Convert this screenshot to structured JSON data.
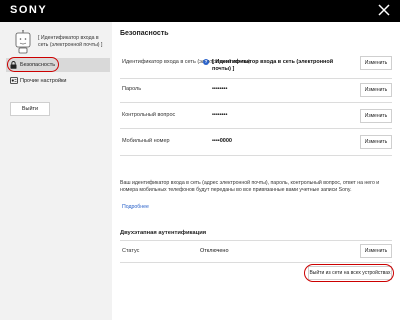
{
  "header": {
    "brand": "SONY"
  },
  "sidebar": {
    "account_id": "[ Идентификатор входа в сеть (электронной почты) ]",
    "nav": [
      {
        "label": "Безопасность"
      },
      {
        "label": "Прочие настройки"
      }
    ],
    "logout_label": "Выйти"
  },
  "main": {
    "title": "Безопасность",
    "rows": [
      {
        "label": "Идентификатор входа в сеть (электронной почты)",
        "value": "[ Идентификатор входа в сеть (электронной почты) ]",
        "button": "Изменить"
      },
      {
        "label": "Пароль",
        "value": "••••••••",
        "button": "Изменить"
      },
      {
        "label": "Контрольный вопрос",
        "value": "••••••••",
        "button": "Изменить"
      },
      {
        "label": "Мобильный номер",
        "value": "••••0000",
        "button": "Изменить"
      }
    ],
    "note": "Ваш идентификатор входа в сеть (адрес электронной почты), пароль, контрольный вопрос, ответ на него и номера мобильных телефонов будут переданы во все привязанные вами учетные записи Sony.",
    "more_link": "Подробнее",
    "two_factor": {
      "title": "Двухэтапная аутентификация",
      "status_label": "Статус",
      "status_value": "Отключено",
      "button": "Изменить"
    },
    "signout_all_label": "Выйти из сети на всех устройствах"
  },
  "colors": {
    "header_bg": "#000000",
    "accent": "#2a62c9",
    "highlight_ring": "#cc0000"
  },
  "icons": {
    "close": "close-icon",
    "avatar": "robot-avatar-icon",
    "security": "lock-icon",
    "other": "settings-card-icon",
    "help": "help-icon"
  }
}
